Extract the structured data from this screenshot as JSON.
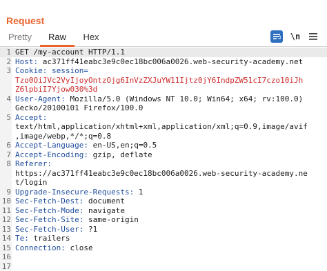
{
  "panel": {
    "title": "Request"
  },
  "tabs": [
    {
      "label": "Pretty"
    },
    {
      "label": "Raw"
    },
    {
      "label": "Hex"
    }
  ],
  "toolbar": {
    "wrap_icon": "wrap-lines-icon",
    "newline_label": "\\n",
    "menu_icon": "hamburger-menu-icon"
  },
  "lines": [
    {
      "num": "1",
      "text": "GET /my-account HTTP/1.1"
    },
    {
      "num": "2",
      "key": "Host:",
      "value": " ac371ff41eabc3e9c0ec18bc006a0026.web-security-academy.net"
    },
    {
      "num": "3",
      "key": "Cookie:",
      "value": " session="
    },
    {
      "num": "",
      "cont": "Tzo0OiJVc2VyIjoyOntzOjg6InVzZXJuYW11Ijtz0jY6IndpZW51cI7czo10iJh"
    },
    {
      "num": "",
      "cont": "Z6lpbiI7Yjow030%3d"
    },
    {
      "num": "4",
      "key": "User-Agent:",
      "value": " Mozilla/5.0 (Windows NT 10.0; Win64; x64; rv:100.0)"
    },
    {
      "num": "",
      "text": "Gecko/20100101 Firefox/100.0"
    },
    {
      "num": "5",
      "key": "Accept:",
      "value": ""
    },
    {
      "num": "",
      "text": "text/html,application/xhtml+xml,application/xml;q=0.9,image/avif"
    },
    {
      "num": "",
      "text": ",image/webp,*/*;q=0.8"
    },
    {
      "num": "6",
      "key": "Accept-Language:",
      "value": " en-US,en;q=0.5"
    },
    {
      "num": "7",
      "key": "Accept-Encoding:",
      "value": " gzip, deflate"
    },
    {
      "num": "8",
      "key": "Referer:",
      "value": ""
    },
    {
      "num": "",
      "text": "https://ac371ff41eabc3e9c0ec18bc006a0026.web-security-academy.ne"
    },
    {
      "num": "",
      "text": "t/login"
    },
    {
      "num": "9",
      "key": "Upgrade-Insecure-Requests:",
      "value": " 1"
    },
    {
      "num": "10",
      "key": "Sec-Fetch-Dest:",
      "value": " document"
    },
    {
      "num": "11",
      "key": "Sec-Fetch-Mode:",
      "value": " navigate"
    },
    {
      "num": "12",
      "key": "Sec-Fetch-Site:",
      "value": " same-origin"
    },
    {
      "num": "13",
      "key": "Sec-Fetch-User:",
      "value": " ?1"
    },
    {
      "num": "14",
      "key": "Te:",
      "value": " trailers"
    },
    {
      "num": "15",
      "key": "Connection:",
      "value": " close"
    },
    {
      "num": "16",
      "text": ""
    },
    {
      "num": "17",
      "text": ""
    }
  ],
  "colors": {
    "accent": "#e8642c",
    "header_key": "#1f4e9e",
    "cookie_value": "#cc2a2a",
    "wrap_button": "#2f6fbf"
  }
}
